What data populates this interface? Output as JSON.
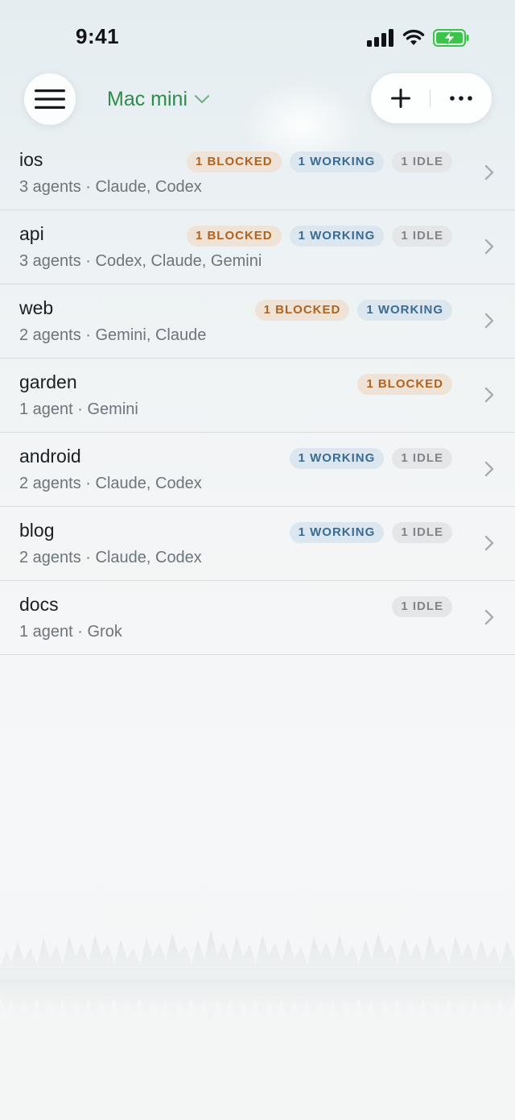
{
  "status_bar": {
    "time": "9:41"
  },
  "nav": {
    "device_name": "Mac mini"
  },
  "colors": {
    "accent": "#2e8b4a",
    "blocked_text": "#b0631f",
    "blocked_bg": "#efe3d7",
    "working_text": "#3b6b92",
    "working_bg": "#dbe6ee",
    "idle_text": "#80868b",
    "idle_bg": "#e4e6e8",
    "battery": "#3bc44a"
  },
  "icons": {
    "menu": "hamburger-menu-icon",
    "device_chevron": "chevron-down-icon",
    "add": "plus-icon",
    "more": "ellipsis-icon",
    "row": "chevron-right-icon",
    "signal": "cellular-signal-icon",
    "wifi": "wifi-icon",
    "battery": "battery-charging-icon"
  },
  "projects": [
    {
      "name": "ios",
      "meta": "3 agents · Claude, Codex",
      "badges": [
        {
          "type": "blocked",
          "label": "1 BLOCKED"
        },
        {
          "type": "working",
          "label": "1 WORKING"
        },
        {
          "type": "idle",
          "label": "1 IDLE"
        }
      ]
    },
    {
      "name": "api",
      "meta": "3 agents · Codex, Claude, Gemini",
      "badges": [
        {
          "type": "blocked",
          "label": "1 BLOCKED"
        },
        {
          "type": "working",
          "label": "1 WORKING"
        },
        {
          "type": "idle",
          "label": "1 IDLE"
        }
      ]
    },
    {
      "name": "web",
      "meta": "2 agents · Gemini, Claude",
      "badges": [
        {
          "type": "blocked",
          "label": "1 BLOCKED"
        },
        {
          "type": "working",
          "label": "1 WORKING"
        }
      ]
    },
    {
      "name": "garden",
      "meta": "1 agent · Gemini",
      "badges": [
        {
          "type": "blocked",
          "label": "1 BLOCKED"
        }
      ]
    },
    {
      "name": "android",
      "meta": "2 agents · Claude, Codex",
      "badges": [
        {
          "type": "working",
          "label": "1 WORKING"
        },
        {
          "type": "idle",
          "label": "1 IDLE"
        }
      ]
    },
    {
      "name": "blog",
      "meta": "2 agents · Claude, Codex",
      "badges": [
        {
          "type": "working",
          "label": "1 WORKING"
        },
        {
          "type": "idle",
          "label": "1 IDLE"
        }
      ]
    },
    {
      "name": "docs",
      "meta": "1 agent · Grok",
      "badges": [
        {
          "type": "idle",
          "label": "1 IDLE"
        }
      ]
    }
  ]
}
